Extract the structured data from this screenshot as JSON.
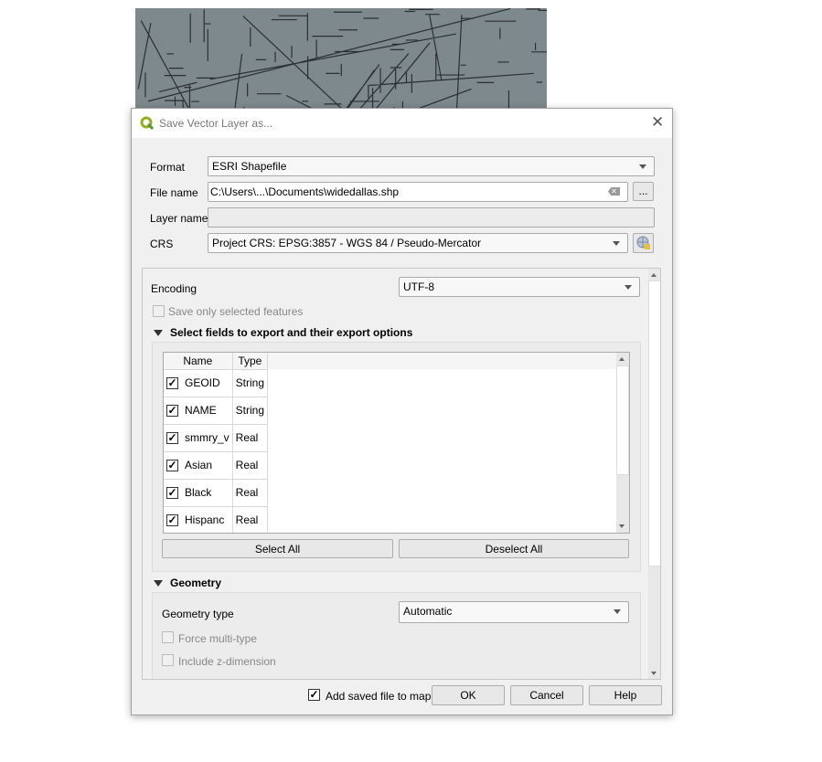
{
  "dialog": {
    "title": "Save Vector Layer as...",
    "close_icon": "close-icon"
  },
  "form": {
    "format_label": "Format",
    "format_value": "ESRI Shapefile",
    "filename_label": "File name",
    "filename_value": "C:\\Users\\...\\Documents\\widedallas.shp",
    "browse_label": "...",
    "layername_label": "Layer name",
    "layername_value": "",
    "crs_label": "CRS",
    "crs_value": "Project CRS: EPSG:3857 - WGS 84 / Pseudo-Mercator"
  },
  "options": {
    "encoding_label": "Encoding",
    "encoding_value": "UTF-8",
    "save_selected_label": "Save only selected features",
    "save_selected_checked": false,
    "fields_section": "Select fields to export and their export options",
    "fields_columns": [
      "Name",
      "Type"
    ],
    "fields": [
      {
        "name": "GEOID",
        "type": "String",
        "checked": true
      },
      {
        "name": "NAME",
        "type": "String",
        "checked": true
      },
      {
        "name": "smmry_v",
        "type": "Real",
        "checked": true
      },
      {
        "name": "Asian",
        "type": "Real",
        "checked": true
      },
      {
        "name": "Black",
        "type": "Real",
        "checked": true
      },
      {
        "name": "Hispanc",
        "type": "Real",
        "checked": true
      }
    ],
    "select_all": "Select All",
    "deselect_all": "Deselect All",
    "geometry_section": "Geometry",
    "geometry_type_label": "Geometry type",
    "geometry_type_value": "Automatic",
    "force_multi_label": "Force multi-type",
    "include_z_label": "Include z-dimension"
  },
  "footer": {
    "add_to_map_label": "Add saved file to map",
    "add_to_map_checked": true,
    "ok": "OK",
    "cancel": "Cancel",
    "help": "Help"
  },
  "colors": {
    "map_fill": "#7d898c",
    "qgis_green": "#93b023"
  }
}
